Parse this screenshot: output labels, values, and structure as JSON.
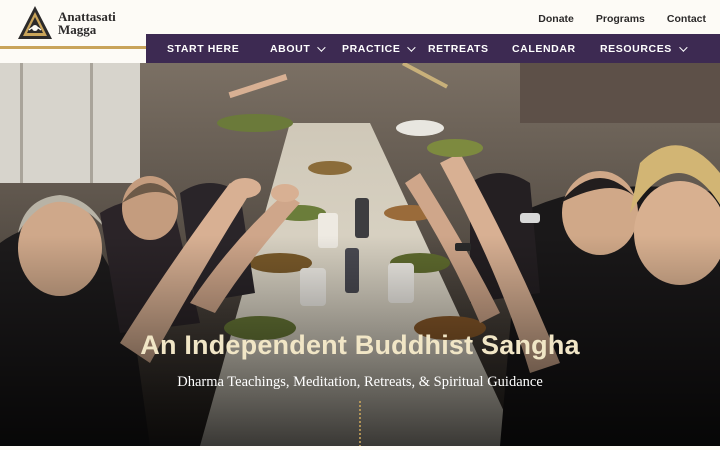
{
  "brand": {
    "line1": "Anattasati",
    "line2": "Magga"
  },
  "utility_nav": [
    "Donate",
    "Programs",
    "Contact"
  ],
  "main_nav": [
    {
      "label": "START HERE",
      "has_dropdown": false
    },
    {
      "label": "ABOUT",
      "has_dropdown": true
    },
    {
      "label": "PRACTICE",
      "has_dropdown": true
    },
    {
      "label": "RETREATS",
      "has_dropdown": false
    },
    {
      "label": "CALENDAR",
      "has_dropdown": false
    },
    {
      "label": "RESOURCES",
      "has_dropdown": true
    }
  ],
  "hero": {
    "title": "An Independent Buddhist Sangha",
    "subtitle": "Dharma Teachings, Meditation, Retreats, & Spiritual Guidance",
    "image": "people-raising-bowls-at-meal-table"
  },
  "colors": {
    "nav_bg": "#3d2a52",
    "accent_gold": "#c9a45a",
    "title_cream": "#f1e6c6",
    "page_bg": "#fdfbf6"
  }
}
